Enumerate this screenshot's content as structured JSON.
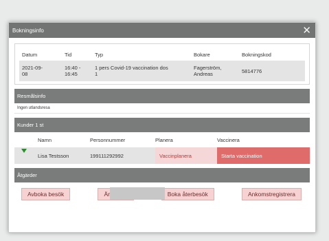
{
  "dialog": {
    "title": "Bokningsinfo",
    "close_glyph": "✕"
  },
  "booking": {
    "headers": [
      "Datum",
      "Tid",
      "Typ",
      "Bokare",
      "Bokningskod"
    ],
    "row": [
      "2021-09-\n08",
      "16:40 -\n16:45",
      "1 pers Covid-19 vaccination dos\n1",
      "Fagerström,\nAndreas",
      "5814776"
    ]
  },
  "resmal": {
    "header": "Resmålsinfo",
    "text": "Ingen utlandsresa"
  },
  "kunder": {
    "header": "Kunder 1 st",
    "columns": [
      "Namn",
      "Personnummer",
      "Planera",
      "Vaccinera"
    ],
    "row": {
      "name": "Lisa Testsson",
      "personnummer": "199111292992",
      "planera": "Vaccinplanera",
      "vaccinera": "Starta vaccination"
    }
  },
  "atgarder": {
    "header": "Åtgärder",
    "buttons": [
      "Avboka besök",
      "Ändra tid",
      "Boka återbesök",
      "Ankomstregistrera"
    ]
  },
  "icons": {
    "expand": "chevron-down-icon",
    "close": "close-icon"
  },
  "colors": {
    "titlebar": "#727474",
    "section": "#7a7b7b",
    "button_bg": "#f6d2d2",
    "vaccinate_bg": "#df6b6b"
  }
}
